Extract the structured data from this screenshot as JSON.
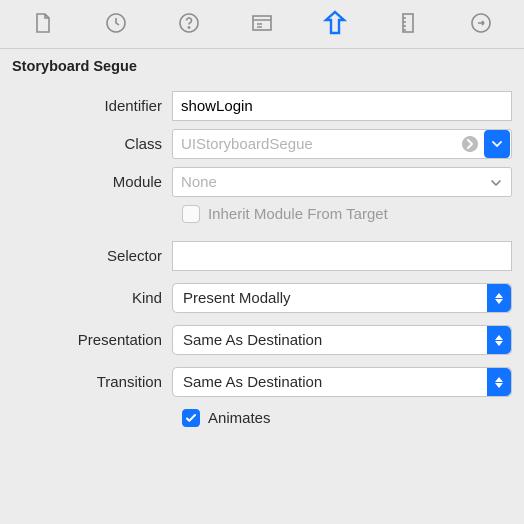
{
  "section_title": "Storyboard Segue",
  "labels": {
    "identifier": "Identifier",
    "class": "Class",
    "module": "Module",
    "inherit": "Inherit Module From Target",
    "selector": "Selector",
    "kind": "Kind",
    "presentation": "Presentation",
    "transition": "Transition",
    "animates": "Animates"
  },
  "values": {
    "identifier": "showLogin",
    "class_placeholder": "UIStoryboardSegue",
    "module_placeholder": "None",
    "selector": "",
    "kind": "Present Modally",
    "presentation": "Same As Destination",
    "transition": "Same As Destination"
  },
  "state": {
    "inherit_checked": false,
    "animates_checked": true,
    "active_inspector": "attributes"
  }
}
